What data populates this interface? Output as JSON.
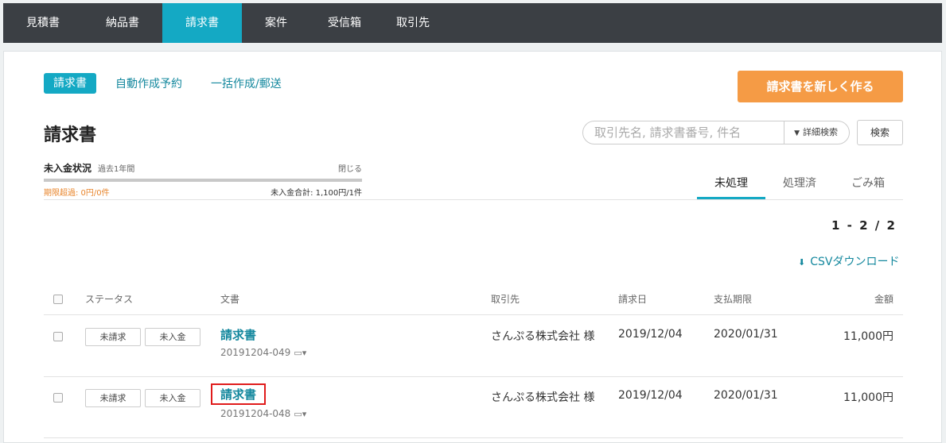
{
  "topnav": {
    "tabs": [
      {
        "label": "見積書"
      },
      {
        "label": "納品書"
      },
      {
        "label": "請求書"
      },
      {
        "label": "案件"
      },
      {
        "label": "受信箱"
      },
      {
        "label": "取引先"
      }
    ],
    "active": "請求書",
    "accent": "#14a9c4"
  },
  "subtabs": [
    {
      "label": "請求書"
    },
    {
      "label": "自動作成予約"
    },
    {
      "label": "一括作成/郵送"
    }
  ],
  "new_button": {
    "label": "請求書を新しく作る",
    "color": "#f59b45"
  },
  "page_title": "請求書",
  "search": {
    "placeholder": "取引先名, 請求書番号, 件名",
    "advanced_label": "詳細検索",
    "button_label": "検索"
  },
  "unpaid_status": {
    "title": "未入金状況",
    "period": "過去1年間",
    "close_label": "閉じる",
    "overdue": "期限超過: 0円/0件",
    "total": "未入金合計: 1,100円/1件"
  },
  "filter_tabs": [
    {
      "label": "未処理"
    },
    {
      "label": "処理済"
    },
    {
      "label": "ごみ箱"
    }
  ],
  "pager": "1 - 2 / 2",
  "csv_label": "CSVダウンロード",
  "table": {
    "columns": {
      "status": "ステータス",
      "document": "文書",
      "client": "取引先",
      "billing_date": "請求日",
      "due_date": "支払期限",
      "amount": "金額"
    },
    "rows": [
      {
        "status1": "未請求",
        "status2": "未入金",
        "title": "請求書",
        "number": "20191204-049",
        "client": "さんぷる株式会社 様",
        "billing_date": "2019/12/04",
        "due_date": "2020/01/31",
        "amount": "11,000円"
      },
      {
        "status1": "未請求",
        "status2": "未入金",
        "title": "請求書",
        "number": "20191204-048",
        "client": "さんぷる株式会社 様",
        "billing_date": "2019/12/04",
        "due_date": "2020/01/31",
        "amount": "11,000円"
      }
    ]
  }
}
